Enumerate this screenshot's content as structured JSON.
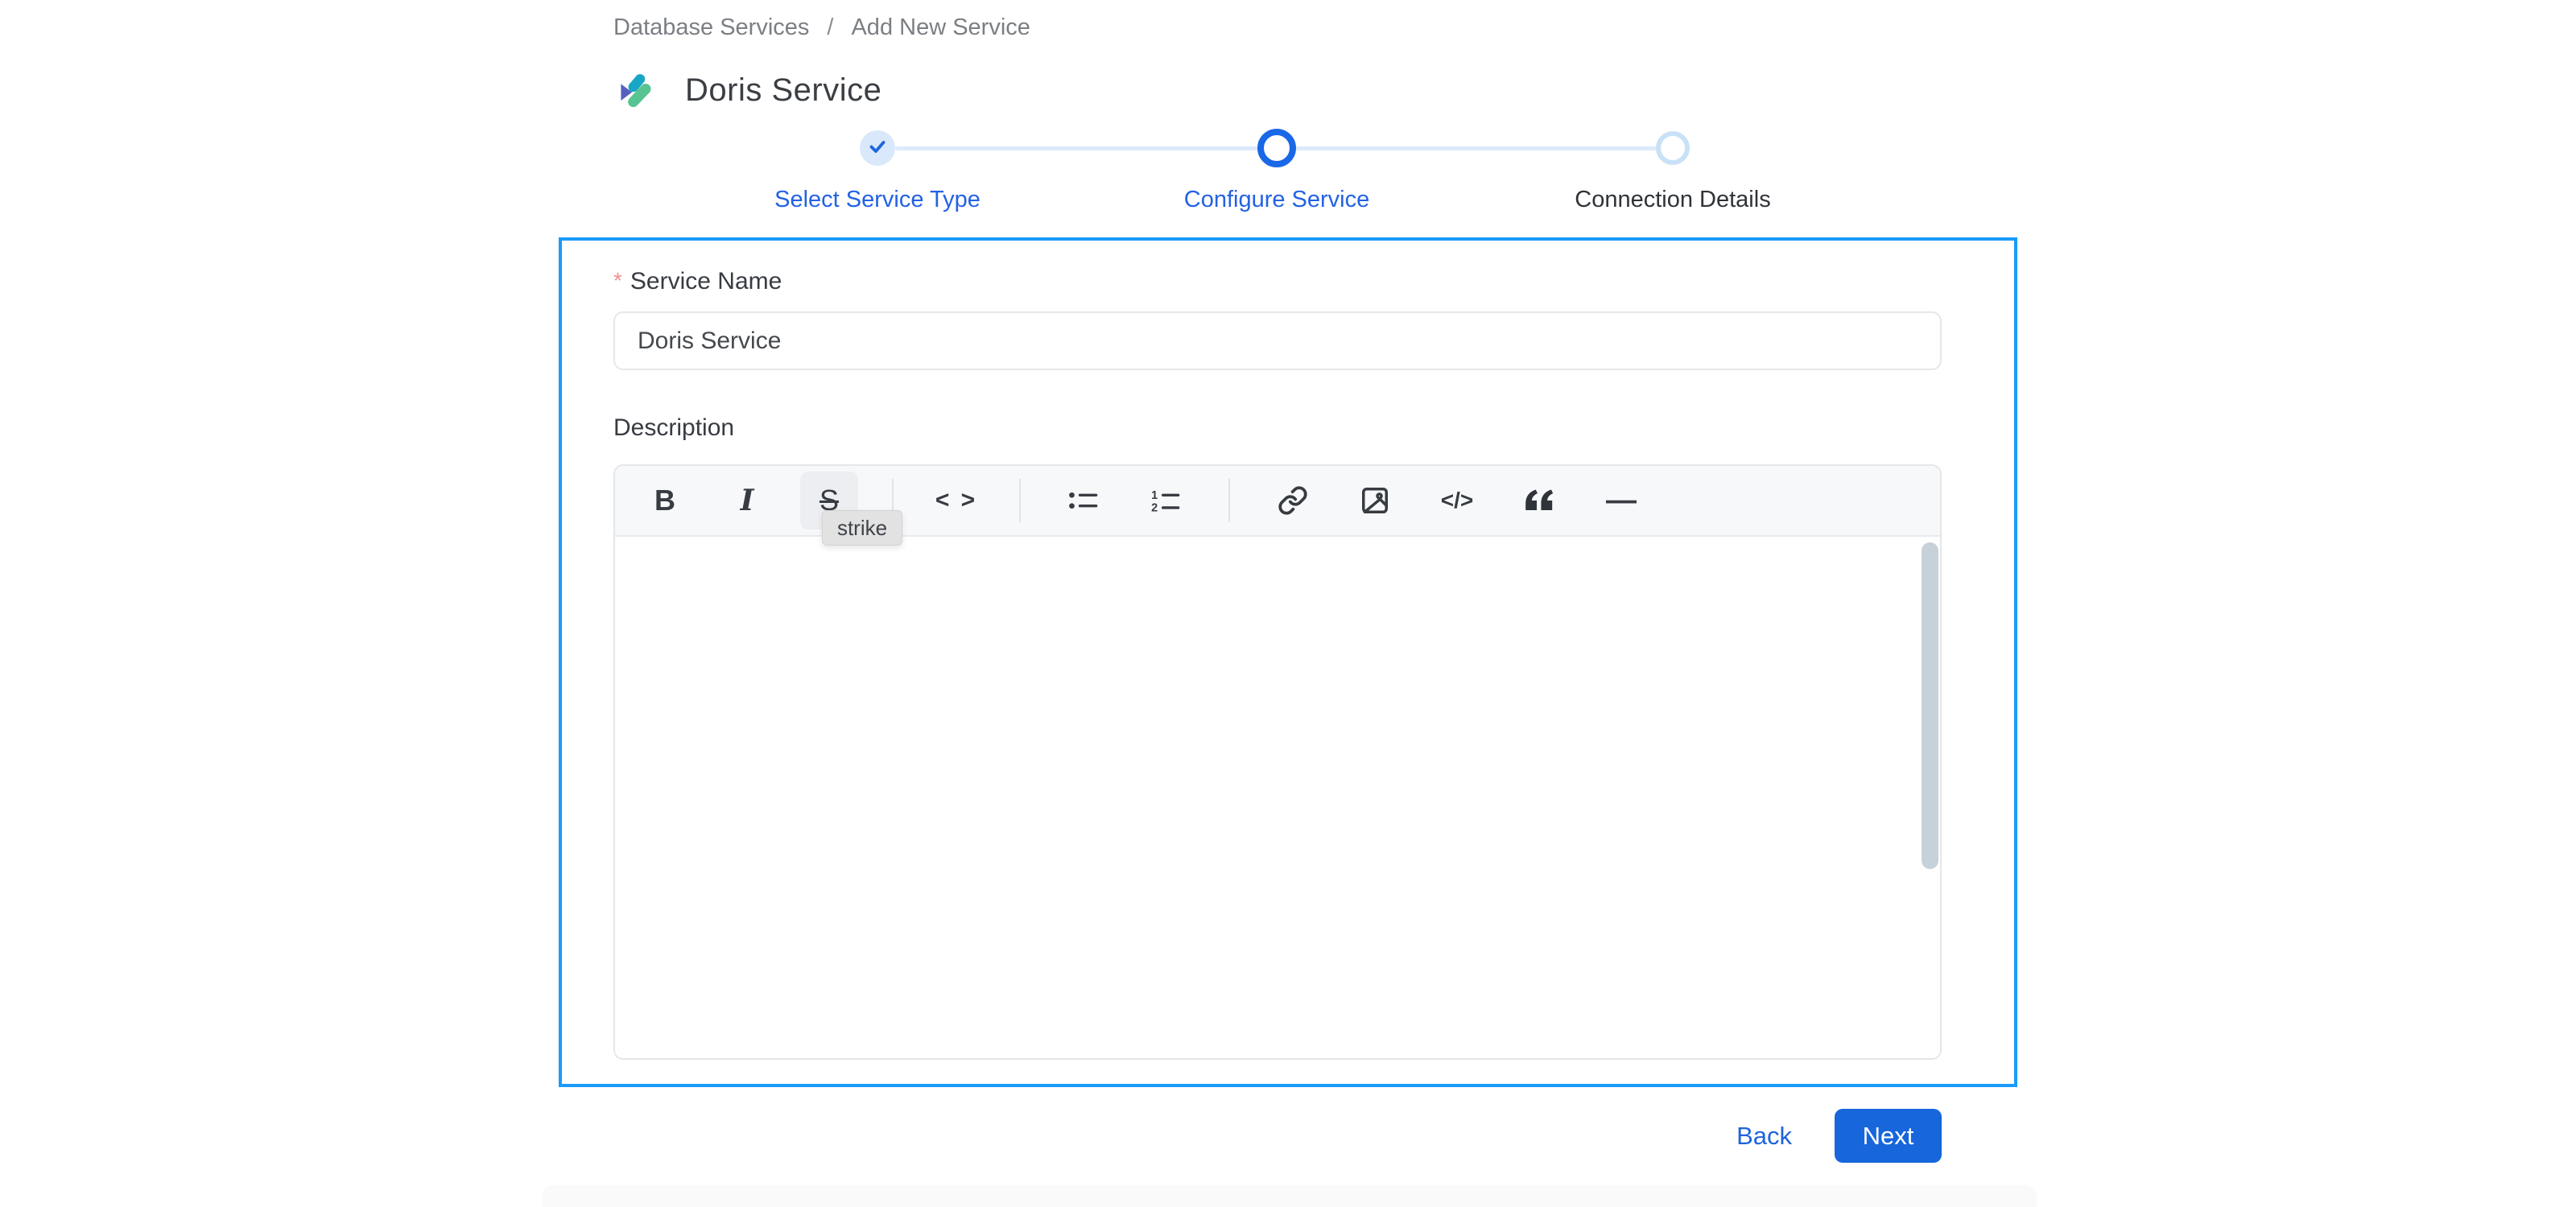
{
  "breadcrumb": {
    "items": [
      "Database Services",
      "Add New Service"
    ],
    "separator": "/"
  },
  "header": {
    "title": "Doris Service",
    "icon": "doris-logo"
  },
  "stepper": {
    "steps": [
      {
        "label": "Select Service Type",
        "state": "completed"
      },
      {
        "label": "Configure Service",
        "state": "active"
      },
      {
        "label": "Connection Details",
        "state": "pending"
      }
    ]
  },
  "form": {
    "service_name": {
      "label": "Service Name",
      "required": true,
      "required_mark": "*",
      "value": "Doris Service"
    },
    "description": {
      "label": "Description",
      "value": ""
    },
    "editor": {
      "tooltip": "strike",
      "toolbar": {
        "bold": "B",
        "italic": "I",
        "strike": "S",
        "inline_code": "< >",
        "bullet_list": "bullet-list-icon",
        "ordered_list": "ordered-list-icon",
        "link": "link-icon",
        "image": "image-icon",
        "code_block": "</>",
        "blockquote": "quote-icon",
        "horizontal_rule": "—"
      }
    }
  },
  "actions": {
    "back": "Back",
    "next": "Next"
  },
  "colors": {
    "primary_blue": "#1766db",
    "step_blue": "#1a67e8",
    "step_done_bg": "#d9e9fb",
    "step_pending_ring": "#c9e1f8",
    "focus_border": "#189bfa",
    "required_red": "#f28f8f",
    "toolbar_bg": "#f7f8fa",
    "tooltip_bg": "#e2e2e3",
    "scrollbar_thumb": "#c7d1da",
    "logo_teal": "#18a6c7",
    "logo_purple": "#5661bf",
    "logo_green": "#58c492"
  }
}
